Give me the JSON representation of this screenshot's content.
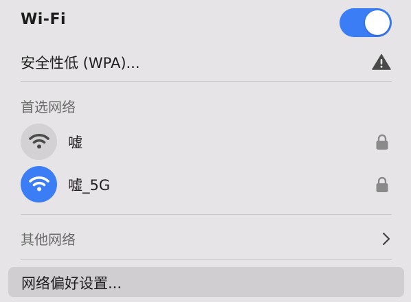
{
  "header": {
    "title": "Wi-Fi",
    "toggle_on": true
  },
  "current": {
    "security_text": "安全性低 (WPA)..."
  },
  "preferred": {
    "label": "首选网络",
    "networks": [
      {
        "name": "嘘",
        "active": false,
        "secured": true
      },
      {
        "name": "嘘_5G",
        "active": true,
        "secured": true
      }
    ]
  },
  "other": {
    "label": "其他网络"
  },
  "prefs": {
    "label": "网络偏好设置..."
  },
  "colors": {
    "accent": "#3a7df5",
    "background": "#e6e4e6",
    "highlight": "#d0ced0",
    "inactive_icon_bg": "#d3d1d3"
  },
  "icons": {
    "warning": "warning-triangle-icon",
    "lock": "lock-icon",
    "wifi": "wifi-icon",
    "chevron": "chevron-right-icon"
  }
}
